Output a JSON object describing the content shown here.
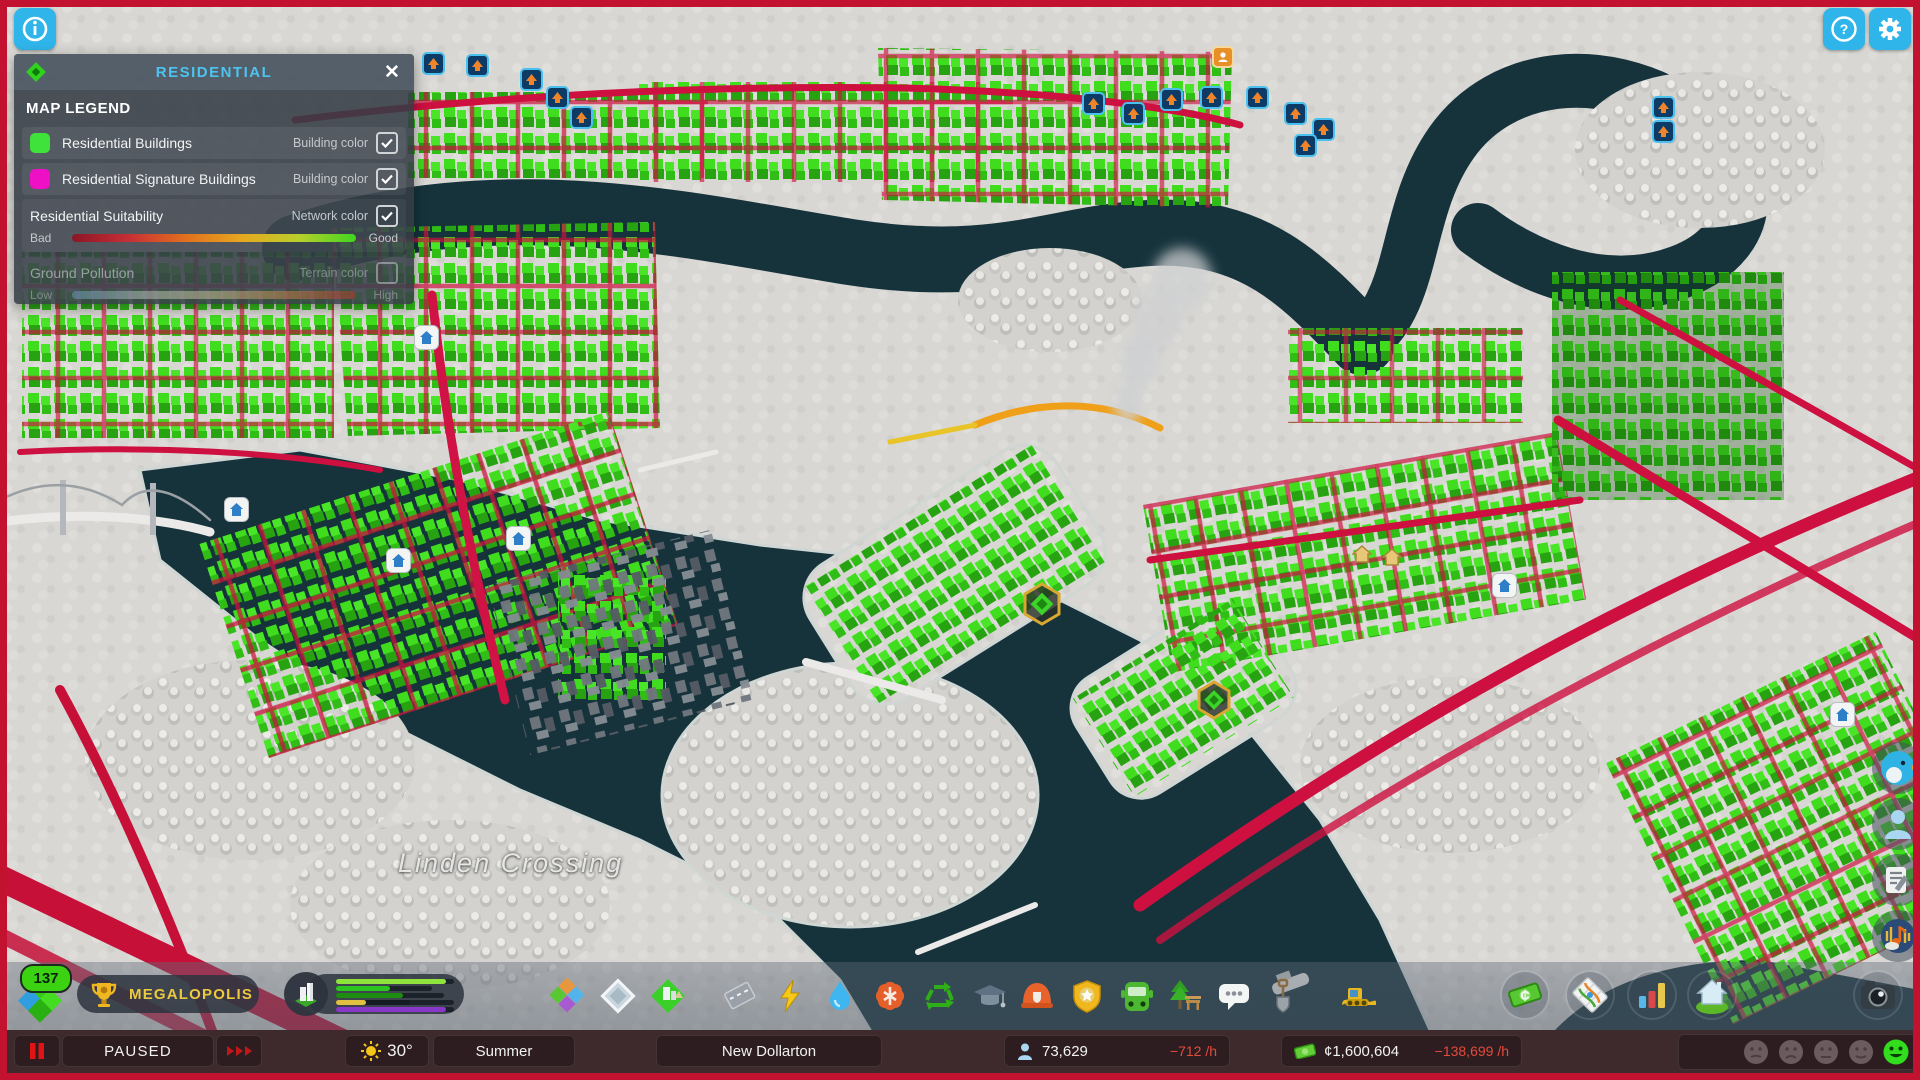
{
  "window": {
    "frame_color": "#c2122f"
  },
  "top_bar": {
    "info_icon": "info-circle",
    "help_label": "?",
    "settings_icon": "gear"
  },
  "infoview_panel": {
    "title": "RESIDENTIAL",
    "title_color": "#4dc4f0",
    "panel_icon": "residential-zone-diamond",
    "close_icon": "✕",
    "section_title": "MAP LEGEND",
    "legend_rows": [
      {
        "swatch_color": "#3fe23a",
        "label": "Residential Buildings",
        "mode_label": "Building color",
        "checked": true
      },
      {
        "swatch_color": "#ee10c4",
        "label": "Residential Signature Buildings",
        "mode_label": "Building color",
        "checked": true
      },
      {
        "label": "Residential Suitability",
        "mode_label": "Network color",
        "checked": true,
        "scale_start": "Bad",
        "scale_end": "Good",
        "gradient": [
          "#8c1626",
          "#c62f35",
          "#e2701e",
          "#e7a81f",
          "#b9cf2c",
          "#3fd61f"
        ]
      },
      {
        "label": "Ground Pollution",
        "mode_label": "Terrain color",
        "checked": false,
        "disabled": true,
        "scale_start": "Low",
        "scale_end": "High",
        "gradient": [
          "#6f9fc4",
          "#c2c8c4",
          "#d6c9a0",
          "#cf8a50",
          "#c0392b"
        ]
      }
    ]
  },
  "map": {
    "district_label": "Linden Crossing",
    "marker_icons": [
      "level-up-badge",
      "residential-service-icon",
      "signature-hex-marker",
      "landmark-house-marker",
      "citizen-marker"
    ],
    "colors": {
      "water": "#16333c",
      "terrain": "#d8d7d3",
      "residential_highlight": "#3fdc1e",
      "bad_suitability_road": "#ce1040",
      "warning_road": "#f0a018"
    }
  },
  "progression": {
    "milestone_level": "137",
    "city_title": "MEGALOPOLIS",
    "demand_bars": [
      {
        "name": "residential-low",
        "color": "#8ee43c",
        "pct": 93
      },
      {
        "name": "residential-medium",
        "color": "#2cc41e",
        "pct": 56
      },
      {
        "name": "residential-high",
        "color": "#1e8c10",
        "pct": 62
      },
      {
        "name": "commercial",
        "color": "#3a4450",
        "pct": 0
      },
      {
        "name": "industrial",
        "color": "#e0c040",
        "pct": 40
      },
      {
        "name": "office",
        "color": "#8838c8",
        "pct": 93
      }
    ]
  },
  "toolbar": {
    "tools": [
      "zones",
      "areas",
      "signature-buildings",
      "roads",
      "electricity",
      "water-sewage",
      "healthcare",
      "garbage",
      "education",
      "fire-rescue",
      "police",
      "transportation",
      "parks-recreation",
      "communications",
      "terraforming",
      "bulldozer",
      "economy",
      "info-views",
      "statistics",
      "city-progression",
      "photo-mode"
    ]
  },
  "status_bar": {
    "pause_label": "PAUSED",
    "pause_icon": "pause-bars",
    "speed_icon": "fast-forward-arrows",
    "weather_icon": "sun",
    "temperature": "30°",
    "season": "Summer",
    "city_name": "New Dollarton",
    "population": {
      "icon": "person",
      "value": "73,629",
      "rate": "−712 /h"
    },
    "budget": {
      "icon": "money-bill",
      "value": "¢1,600,604",
      "rate": "−138,699 /h"
    },
    "happiness": {
      "levels": [
        "very-sad",
        "sad",
        "neutral",
        "content",
        "happy"
      ],
      "selected": "happy",
      "selected_color": "#31dd1c"
    }
  }
}
